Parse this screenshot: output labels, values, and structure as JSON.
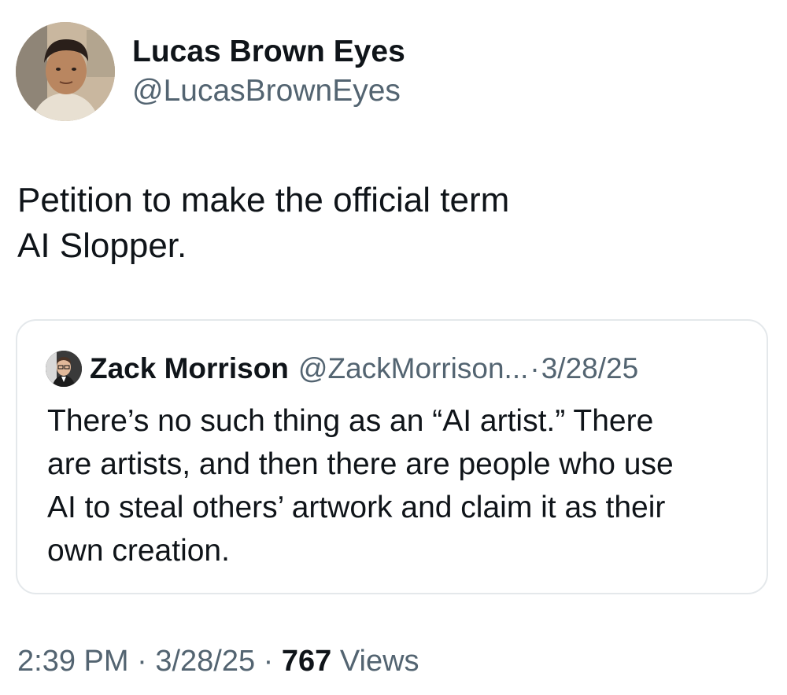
{
  "author": {
    "display_name": "Lucas Brown Eyes",
    "handle": "@LucasBrownEyes"
  },
  "tweet": {
    "text_lines": [
      "Petition to make the official term",
      "AI Slopper."
    ]
  },
  "quoted": {
    "display_name": "Zack Morrison",
    "handle": "@ZackMorrison...",
    "separator": "·",
    "date": "3/28/25",
    "text_lines": [
      "There’s no such thing as an “AI artist.” There",
      "are artists, and then there are people who use",
      "AI to steal others’ artwork and claim it as their",
      "own creation."
    ]
  },
  "meta": {
    "time": "2:39 PM",
    "separator": "·",
    "date": "3/28/25",
    "views_count": "767",
    "views_label": "Views"
  },
  "colors": {
    "primary_text": "#0f1419",
    "secondary_text": "#536471",
    "border": "#e4e8eb"
  },
  "icons": {
    "author_avatar": "profile-photo-avatar",
    "quoted_avatar": "profile-photo-avatar"
  }
}
